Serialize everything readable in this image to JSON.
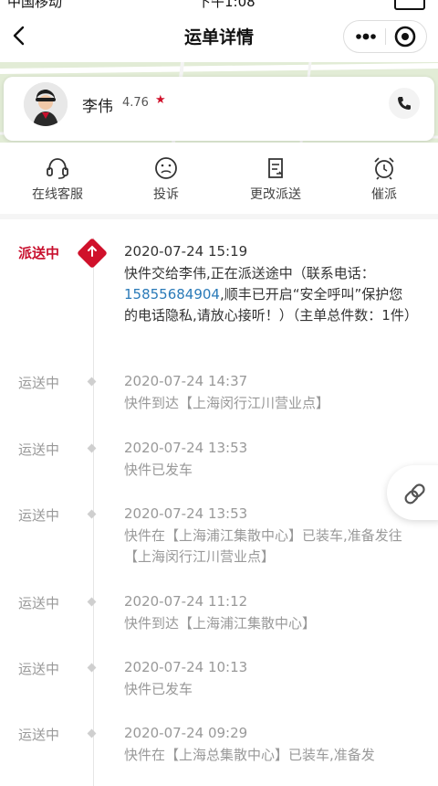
{
  "status_bar": {
    "carrier": "中国移动",
    "time": "下午1:08"
  },
  "nav": {
    "title": "运单详情"
  },
  "courier": {
    "name": "李伟",
    "rating": "4.76"
  },
  "actions": [
    {
      "label": "在线客服",
      "icon": "headset-icon"
    },
    {
      "label": "投诉",
      "icon": "sad-face-icon"
    },
    {
      "label": "更改派送",
      "icon": "edit-document-icon"
    },
    {
      "label": "催派",
      "icon": "alarm-clock-icon"
    }
  ],
  "timeline": [
    {
      "status": "派送中",
      "time": "2020-07-24 15:19",
      "desc_before": "快件交给李伟,正在派送途中（联系电话：",
      "phone": "15855684904",
      "desc_after": ",顺丰已开启“安全呼叫”保护您的电话隐私,请放心接听！）（主单总件数：1件）"
    },
    {
      "status": "运送中",
      "time": "2020-07-24 14:37",
      "desc": "快件到达【上海闵行江川营业点】"
    },
    {
      "status": "运送中",
      "time": "2020-07-24 13:53",
      "desc": "快件已发车"
    },
    {
      "status": "运送中",
      "time": "2020-07-24 13:53",
      "desc": "快件在【上海浦江集散中心】已装车,准备发往【上海闵行江川营业点】"
    },
    {
      "status": "运送中",
      "time": "2020-07-24 11:12",
      "desc": "快件到达【上海浦江集散中心】"
    },
    {
      "status": "运送中",
      "time": "2020-07-24 10:13",
      "desc": "快件已发车"
    },
    {
      "status": "运送中",
      "time": "2020-07-24 09:29",
      "desc": "快件在【上海总集散中心】已装车,准备发"
    }
  ]
}
